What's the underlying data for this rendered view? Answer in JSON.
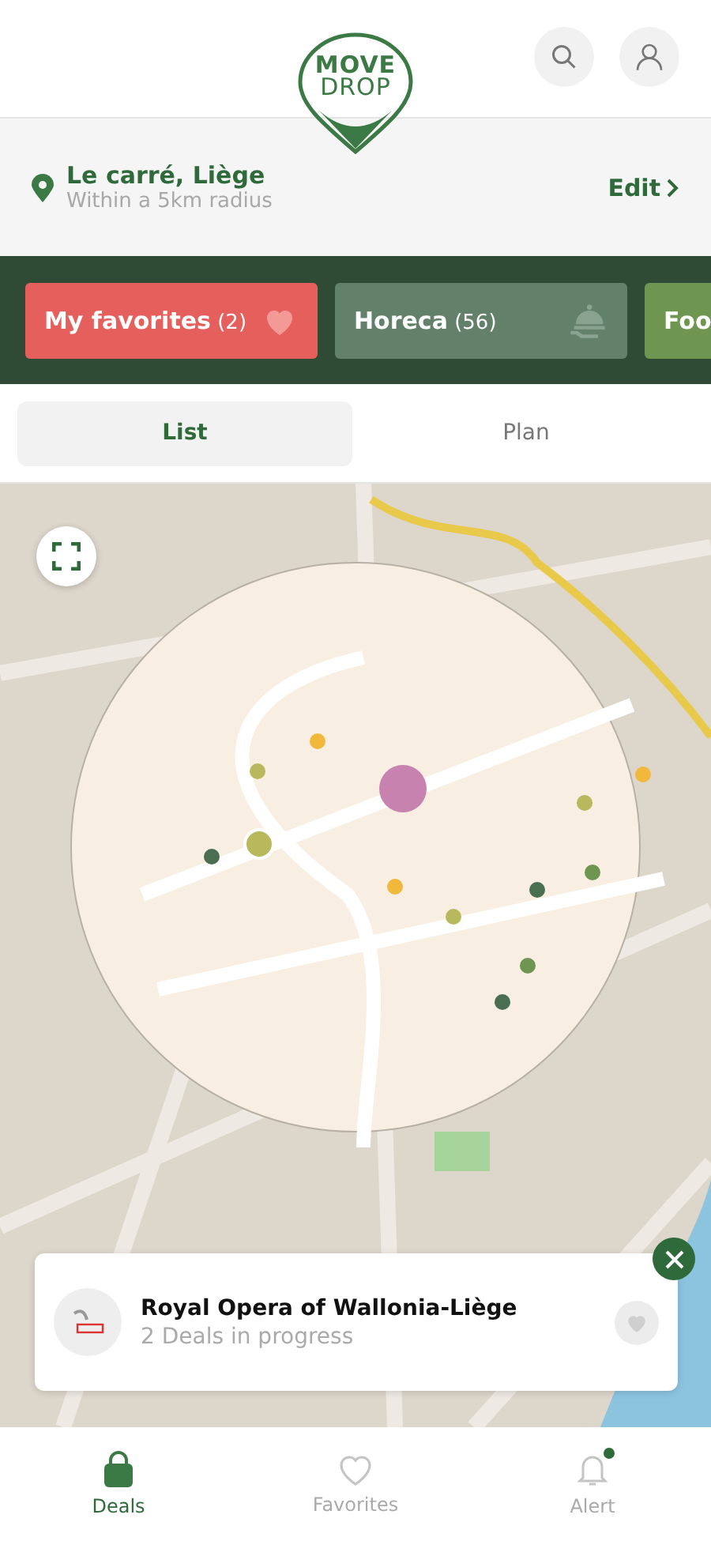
{
  "header": {
    "logo": {
      "line_1": "MOVE",
      "line_2": "DROP"
    }
  },
  "location": {
    "title": "Le carré, Liège",
    "subtitle": "Within a 5km radius",
    "edit": "Edit"
  },
  "categories": [
    {
      "kind": "favorites",
      "label": "My favorites",
      "count": "(2)",
      "color": "#e5605c"
    },
    {
      "kind": "horeca",
      "label": "Horeca",
      "count": "(56)",
      "color": "#62806a"
    },
    {
      "kind": "plain",
      "label": "Foo",
      "color": "#6f9650"
    }
  ],
  "view_tabs": [
    {
      "label": "List",
      "selected": true
    },
    {
      "label": "Plan",
      "selected": false
    }
  ],
  "place_card": {
    "name": "Royal Opera of Wallonia-Liège",
    "subtitle": "2 Deals in progress",
    "favorite": false
  },
  "bottom_nav": [
    {
      "kind": "deals",
      "label": "Deals",
      "selected": true,
      "badge": false
    },
    {
      "kind": "favorites",
      "label": "Favorites",
      "selected": false,
      "badge": false
    },
    {
      "kind": "alert",
      "label": "Alert",
      "selected": false,
      "badge": true
    }
  ]
}
